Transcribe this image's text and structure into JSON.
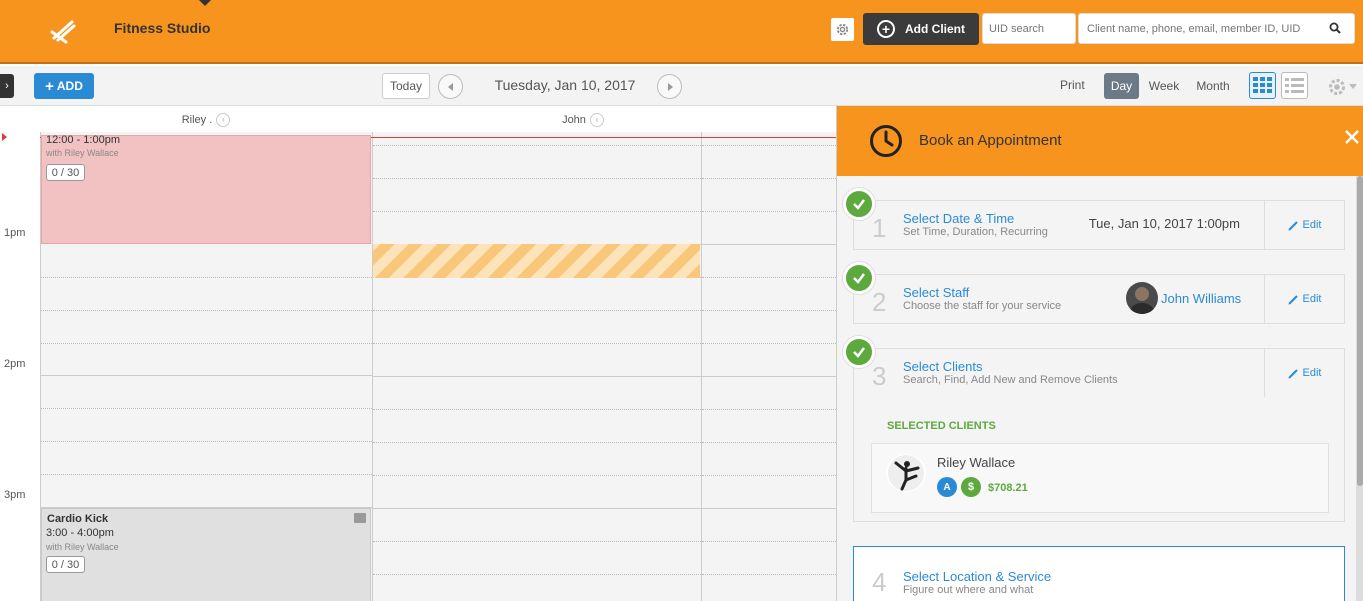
{
  "header": {
    "brand": "Fitness Studio",
    "add_client_label": "Add Client",
    "uid_search_placeholder": "UID search",
    "client_search_placeholder": "Client name, phone, email, member ID, UID"
  },
  "toolbar": {
    "add_label": "ADD",
    "today_label": "Today",
    "date": "Tuesday, Jan 10, 2017",
    "print_label": "Print",
    "views": [
      {
        "label": "Day",
        "active": true
      },
      {
        "label": "Week",
        "active": false
      },
      {
        "label": "Month",
        "active": false
      }
    ]
  },
  "calendar": {
    "columns": [
      {
        "name": "Riley ."
      },
      {
        "name": "John"
      }
    ],
    "time_labels": [
      "1pm",
      "2pm",
      "3pm"
    ],
    "events": [
      {
        "time": "12:00 - 1:00pm",
        "with": "with Riley Wallace",
        "capacity": "0 / 30",
        "color": "#f2c2c2"
      },
      {
        "title": "Cardio Kick",
        "time": "3:00 - 4:00pm",
        "with": "with Riley Wallace",
        "capacity": "0 / 30",
        "color": "#e0e0e0"
      }
    ]
  },
  "panel": {
    "title": "Book an Appointment",
    "steps": [
      {
        "num": "1",
        "title": "Select Date & Time",
        "sub": "Set Time, Duration, Recurring",
        "value": "Tue, Jan 10, 2017 1:00pm",
        "edit": "Edit"
      },
      {
        "num": "2",
        "title": "Select Staff",
        "sub": "Choose the staff for your service",
        "staff": "John Williams",
        "edit": "Edit"
      },
      {
        "num": "3",
        "title": "Select Clients",
        "sub": "Search, Find, Add New and Remove Clients",
        "edit": "Edit"
      },
      {
        "num": "4",
        "title": "Select Location & Service",
        "sub": "Figure out where and what"
      }
    ],
    "selected_clients_label": "SELECTED CLIENTS",
    "client": {
      "name": "Riley Wallace",
      "badge_a": "A",
      "badge_dollar": "$",
      "balance": "$708.21"
    }
  },
  "colors": {
    "accent": "#f7941d",
    "link": "#2a8bd4",
    "success": "#5da93e",
    "now_line": "#e53935"
  }
}
